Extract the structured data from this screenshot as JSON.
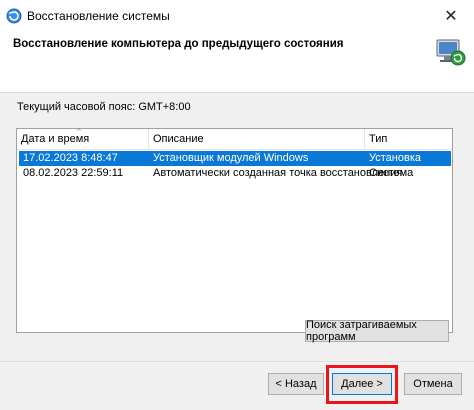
{
  "window": {
    "title": "Восстановление системы",
    "close_glyph": "✕"
  },
  "header": {
    "title": "Восстановление компьютера до предыдущего состояния",
    "icon": "restore-monitor-icon"
  },
  "timezone": {
    "label": "Текущий часовой пояс: GMT+8:00"
  },
  "table": {
    "columns": [
      "Дата и время",
      "Описание",
      "Тип"
    ],
    "sort_glyph": "^",
    "rows": [
      {
        "date": "17.02.2023 8:48:47",
        "description": "Установщик модулей Windows",
        "type": "Установка",
        "selected": true
      },
      {
        "date": "08.02.2023 22:59:11",
        "description": "Автоматически созданная точка восстановления",
        "type": "Система",
        "selected": false
      }
    ]
  },
  "buttons": {
    "scan": "Поиск затрагиваемых программ",
    "back": "< Назад",
    "next": "Далее >",
    "cancel": "Отмена"
  },
  "colors": {
    "selection": "#0a78d7",
    "highlight": "#e8151b",
    "accent": "#0078d7"
  }
}
